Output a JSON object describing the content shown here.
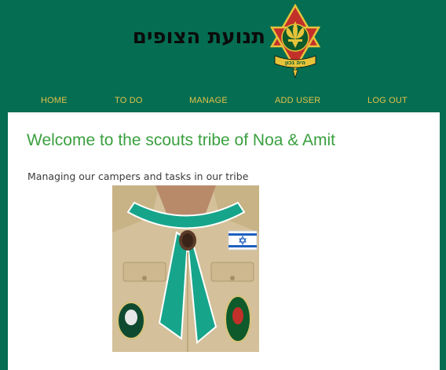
{
  "header": {
    "site_title": "תנועת הצופים",
    "logo": {
      "name": "scouts-emblem",
      "motto": "היה נכון"
    }
  },
  "nav": {
    "items": [
      {
        "label": "HOME"
      },
      {
        "label": "TO DO"
      },
      {
        "label": "MANAGE"
      },
      {
        "label": "ADD USER"
      },
      {
        "label": "LOG OUT"
      }
    ]
  },
  "main": {
    "welcome": "Welcome to the scouts tribe of Noa & Amit",
    "subtitle": "Managing our campers and tasks in our tribe",
    "image": {
      "name": "scout-uniform-photo"
    }
  },
  "colors": {
    "header_bg": "#056d51",
    "nav_text": "#e3c14a",
    "welcome_text": "#3aa03f",
    "scarf": "#16a58a",
    "shirt": "#d4c09a"
  }
}
